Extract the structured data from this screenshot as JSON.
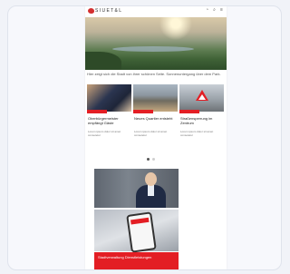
{
  "header": {
    "logo_text": "S I U E T & L",
    "icons": [
      "user-icon",
      "search-icon",
      "menu-icon"
    ]
  },
  "hero": {
    "caption": "Hier zeigt sich die Stadt von ihrer schönen Seite. Sonnenuntergang über dem Park."
  },
  "cards": [
    {
      "title": "Oberbürgermeister empfängt Gäste",
      "meta": "Lorem ipsum dolor sit amet consetetur"
    },
    {
      "title": "Neues Quartier entsteht",
      "meta": "Lorem ipsum dolor sit amet consetetur"
    },
    {
      "title": "Straßensperrung im Zentrum",
      "meta": "Lorem ipsum dolor sit amet consetetur"
    }
  ],
  "pager": {
    "count": 2,
    "active": 0
  },
  "banner": {
    "text": "Stadtverwaltung Dienstleistungen"
  },
  "colors": {
    "accent": "#e31e24"
  }
}
